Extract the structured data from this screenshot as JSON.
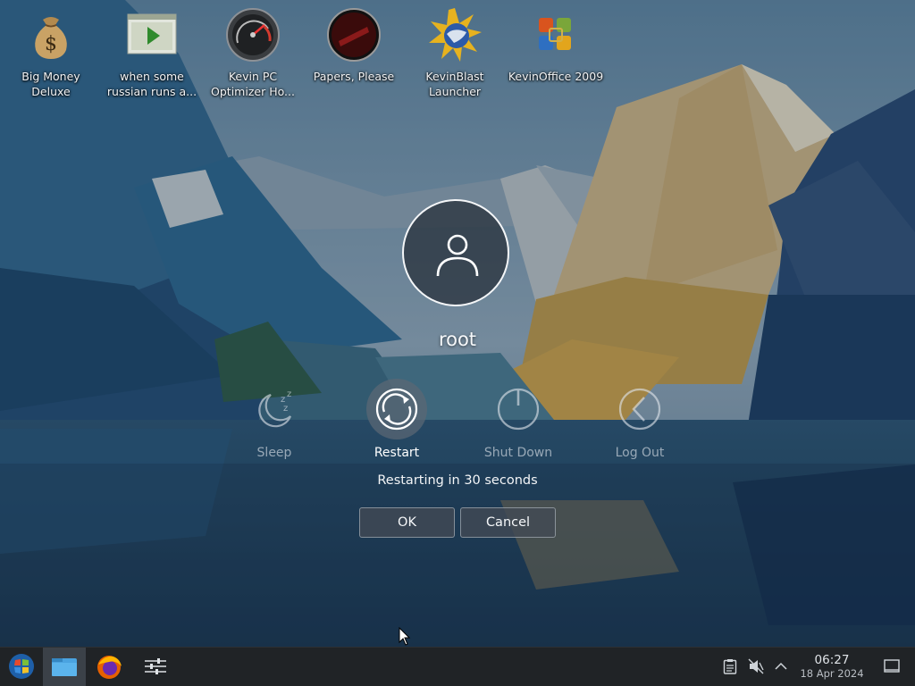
{
  "desktop": {
    "icons": [
      {
        "label": "Big Money Deluxe",
        "icon": "money-bag-icon"
      },
      {
        "label": "when some russian runs a...",
        "icon": "video-file-icon"
      },
      {
        "label": "Kevin PC Optimizer Ho...",
        "icon": "speedometer-icon"
      },
      {
        "label": "Papers, Please",
        "icon": "papers-please-icon"
      },
      {
        "label": "KevinBlast Launcher",
        "icon": "starburst-globe-icon"
      },
      {
        "label": "KevinOffice 2009",
        "icon": "office-icon"
      }
    ]
  },
  "logout_screen": {
    "username": "root",
    "actions": [
      {
        "label": "Sleep",
        "icon": "sleep-icon",
        "selected": false
      },
      {
        "label": "Restart",
        "icon": "restart-icon",
        "selected": true
      },
      {
        "label": "Shut Down",
        "icon": "shutdown-icon",
        "selected": false
      },
      {
        "label": "Log Out",
        "icon": "logout-icon",
        "selected": false
      }
    ],
    "countdown_text": "Restarting in 30 seconds",
    "ok_label": "OK",
    "cancel_label": "Cancel"
  },
  "taskbar": {
    "start_icon": "start-menu-icon",
    "apps": [
      "file-manager-icon",
      "firefox-icon",
      "settings-sliders-icon"
    ],
    "tray": [
      "clipboard-icon",
      "volume-muted-icon",
      "tray-expand-icon"
    ],
    "clock_time": "06:27",
    "clock_date": "18 Apr 2024",
    "show_desktop_icon": "show-desktop-icon"
  },
  "colors": {
    "taskbar": "#202326",
    "accent_text": "#ffffff",
    "inactive_text": "#dee4ea"
  }
}
